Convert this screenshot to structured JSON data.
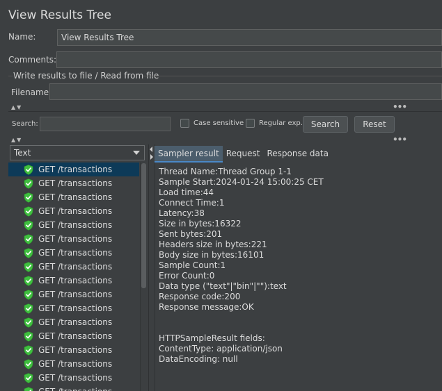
{
  "header": {
    "title": "View Results Tree"
  },
  "name_field": {
    "label": "Name:",
    "value": "View Results Tree"
  },
  "comments_field": {
    "label": "Comments:",
    "value": ""
  },
  "write_results": {
    "legend": "Write results to file / Read from file",
    "filename_label": "Filename",
    "filename_value": ""
  },
  "search": {
    "label": "Search:",
    "value": "",
    "case_sensitive_label": "Case sensitive",
    "regular_exp_label": "Regular exp.",
    "search_button": "Search",
    "reset_button": "Reset"
  },
  "renderer": {
    "selected": "Text"
  },
  "tree": {
    "items": [
      {
        "label": "GET /transactions",
        "selected": true
      },
      {
        "label": "GET /transactions"
      },
      {
        "label": "GET /transactions"
      },
      {
        "label": "GET /transactions"
      },
      {
        "label": "GET /transactions"
      },
      {
        "label": "GET /transactions"
      },
      {
        "label": "GET /transactions"
      },
      {
        "label": "GET /transactions"
      },
      {
        "label": "GET /transactions"
      },
      {
        "label": "GET /transactions"
      },
      {
        "label": "GET /transactions"
      },
      {
        "label": "GET /transactions"
      },
      {
        "label": "GET /transactions"
      },
      {
        "label": "GET /transactions"
      },
      {
        "label": "GET /transactions"
      },
      {
        "label": "GET /transactions"
      },
      {
        "label": "GET /transactions"
      }
    ]
  },
  "tabs": [
    {
      "label": "Sampler result",
      "active": true
    },
    {
      "label": "Request"
    },
    {
      "label": "Response data"
    }
  ],
  "sampler_result": {
    "lines": [
      "Thread Name:Thread Group 1-1",
      "Sample Start:2024-01-24 15:00:25 CET",
      "Load time:44",
      "Connect Time:1",
      "Latency:38",
      "Size in bytes:16322",
      "Sent bytes:201",
      "Headers size in bytes:221",
      "Body size in bytes:16101",
      "Sample Count:1",
      "Error Count:0",
      "Data type (\"text\"|\"bin\"|\"\"):text",
      "Response code:200",
      "Response message:OK",
      "",
      "",
      "HTTPSampleResult fields:",
      "ContentType: application/json",
      "DataEncoding: null"
    ]
  },
  "icons": {
    "success": "shield-check-icon",
    "dropdown": "chevron-down-icon",
    "collapse": "collapse-arrows-icon",
    "more": "more-dots-icon"
  },
  "colors": {
    "background": "#3c3f41",
    "selection": "#0d3a58",
    "success_icon": "#4ec24e",
    "active_tab": "#4b5d6c"
  }
}
